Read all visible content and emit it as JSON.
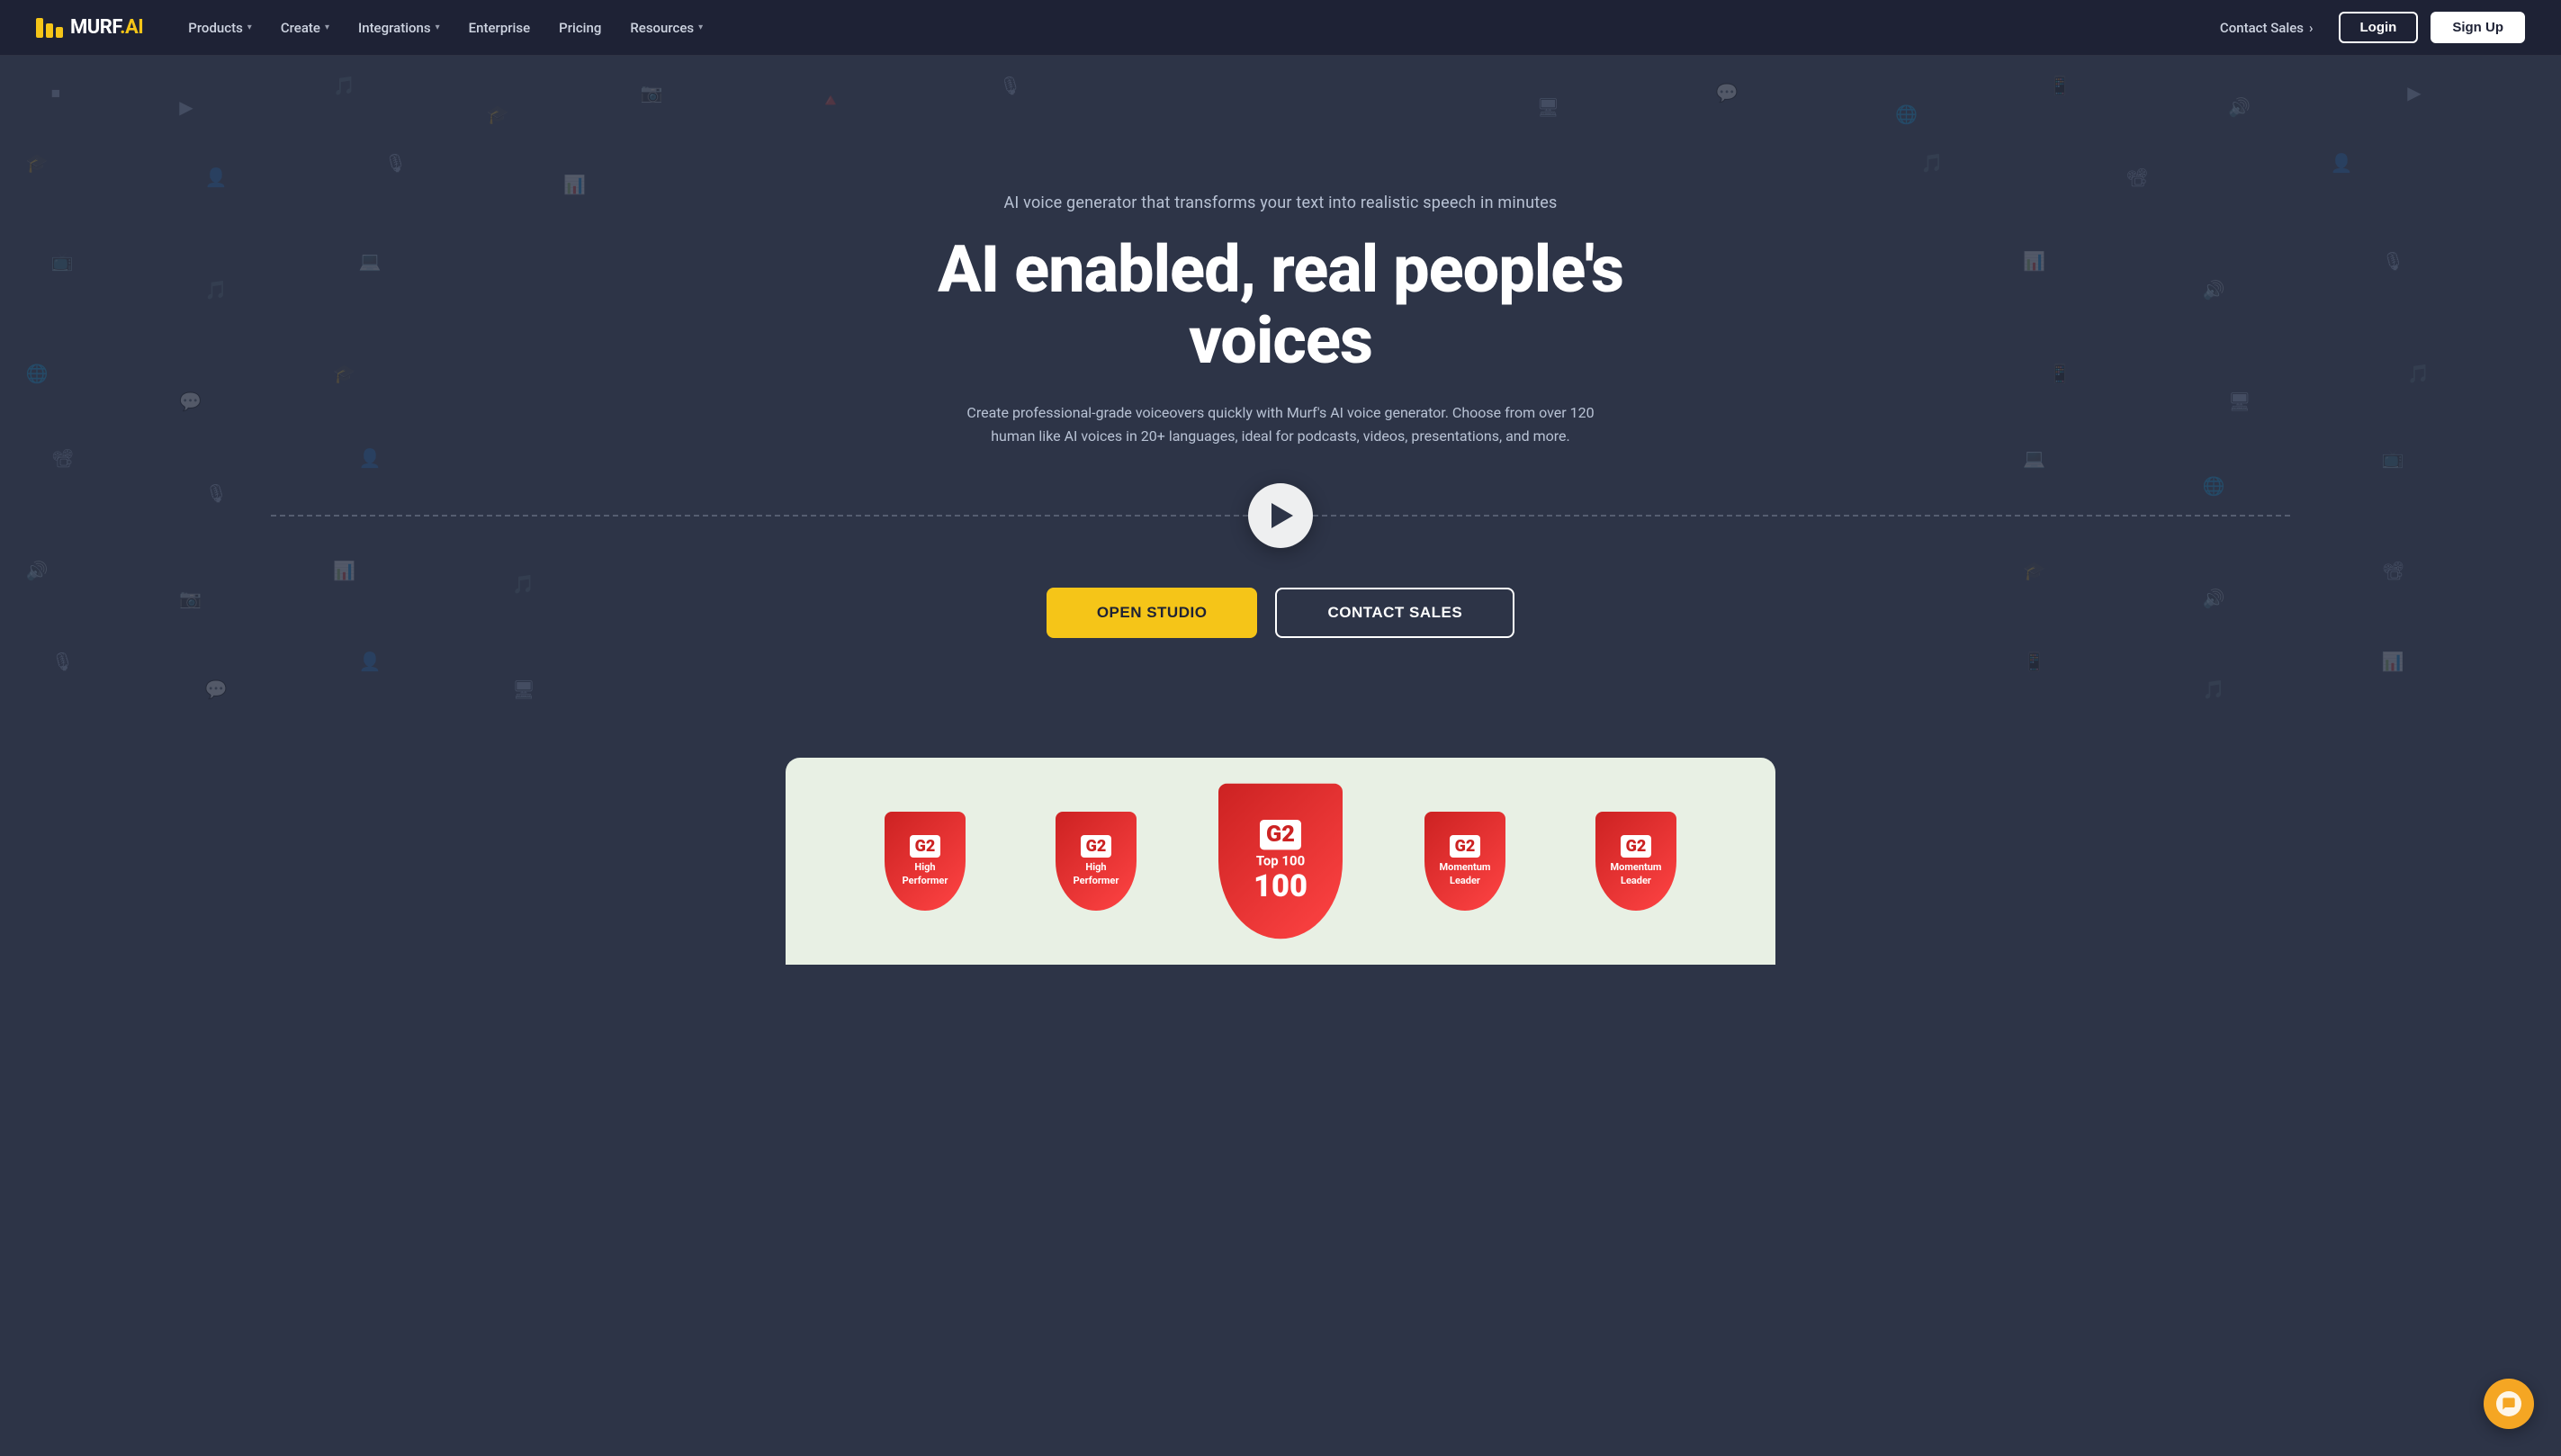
{
  "brand": {
    "name": "MURF",
    "suffix": ".AI",
    "logo_alt": "Murf AI Logo"
  },
  "nav": {
    "items": [
      {
        "label": "Products",
        "has_dropdown": true,
        "id": "products"
      },
      {
        "label": "Create",
        "has_dropdown": true,
        "id": "create"
      },
      {
        "label": "Integrations",
        "has_dropdown": true,
        "id": "integrations"
      },
      {
        "label": "Enterprise",
        "has_dropdown": false,
        "id": "enterprise"
      },
      {
        "label": "Pricing",
        "has_dropdown": false,
        "id": "pricing"
      },
      {
        "label": "Resources",
        "has_dropdown": true,
        "id": "resources"
      }
    ],
    "contact_sales_label": "Contact Sales",
    "contact_sales_arrow": "›",
    "login_label": "Login",
    "signup_label": "Sign Up"
  },
  "hero": {
    "subtitle": "AI voice generator that transforms your text into realistic speech in minutes",
    "title": "AI enabled, real people's voices",
    "description": "Create professional-grade voiceovers quickly with Murf's AI voice generator. Choose from over 120 human like AI voices in 20+ languages, ideal for podcasts, videos, presentations, and more.",
    "play_button_label": "Play demo",
    "open_studio_label": "OPEN STUDIO",
    "contact_sales_label": "CONTACT SALES"
  },
  "awards": {
    "items": [
      {
        "g2_label": "G2",
        "title": "High\nPerformer",
        "rank": "",
        "size": "normal"
      },
      {
        "g2_label": "G2",
        "title": "High\nPerformer",
        "rank": "",
        "size": "normal"
      },
      {
        "g2_label": "G2",
        "title": "Top 100",
        "rank": "100",
        "size": "large"
      },
      {
        "g2_label": "G2",
        "title": "Momentum\nLeader",
        "rank": "",
        "size": "normal"
      },
      {
        "g2_label": "G2",
        "title": "Momentum\nLeader",
        "rank": "",
        "size": "normal"
      }
    ]
  },
  "chat": {
    "button_label": "Chat"
  },
  "colors": {
    "navbar_bg": "#1e2235",
    "hero_bg": "#2d3447",
    "brand_yellow": "#f5c518",
    "awards_bg": "#e8f0e4"
  }
}
